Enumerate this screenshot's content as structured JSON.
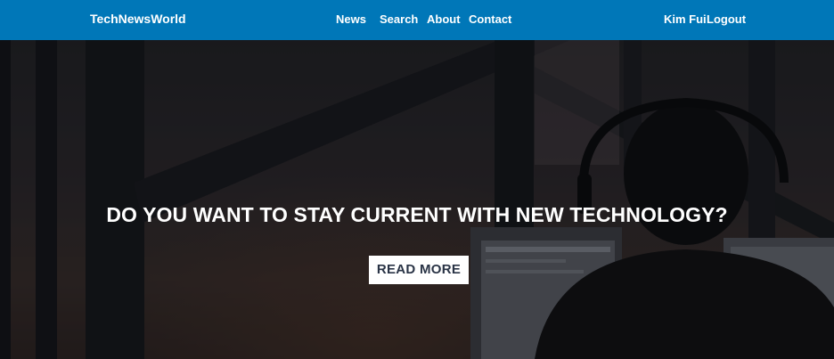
{
  "navbar": {
    "brand": "TechNewsWorld",
    "links": [
      {
        "label": "News"
      },
      {
        "label": "Search"
      },
      {
        "label": "About"
      },
      {
        "label": "Contact"
      }
    ],
    "user": {
      "name": "Kim Fui",
      "logout_label": "Logout"
    }
  },
  "hero": {
    "headline": "DO YOU WANT TO STAY CURRENT WITH NEW TECHNOLOGY?",
    "cta_label": "READ MORE"
  },
  "colors": {
    "navbar_bg": "#0077b8",
    "cta_bg": "#ffffff",
    "cta_text": "#2a3446",
    "headline_text": "#ffffff"
  }
}
